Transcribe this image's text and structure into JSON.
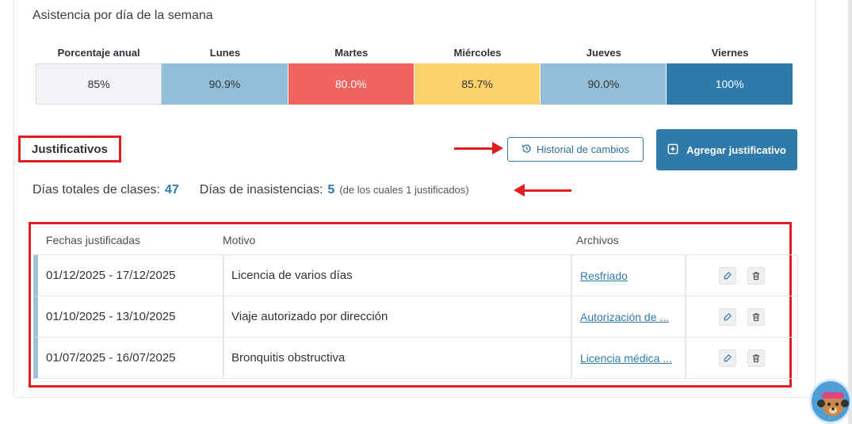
{
  "attendance": {
    "title": "Asistencia por día de la semana",
    "headers": [
      "Porcentaje anual",
      "Lunes",
      "Martes",
      "Miércoles",
      "Jueves",
      "Viernes"
    ],
    "values": [
      "85%",
      "90.9%",
      "80.0%",
      "85.7%",
      "90.0%",
      "100%"
    ],
    "colors": [
      "#f2f3f6",
      "#94bed8",
      "#ef6461",
      "#fdd26b",
      "#94bed8",
      "#2e7bab"
    ],
    "text_colors": [
      "#333333",
      "#2f3337",
      "#ffffff",
      "#2f3337",
      "#2f3337",
      "#ffffff"
    ]
  },
  "justificativos": {
    "title": "Justificativos",
    "history_button": "Historial de cambios",
    "add_button": "Agregar justificativo",
    "total_days_label": "Días totales de clases:",
    "total_days_value": "47",
    "absences_label": "Días de inasistencias:",
    "absences_value": "5",
    "absences_note": "(de los cuales 1 justificados)"
  },
  "table": {
    "headers": {
      "dates": "Fechas justificadas",
      "reason": "Motivo",
      "files": "Archivos"
    },
    "rows": [
      {
        "dates": "01/12/2025 - 17/12/2025",
        "reason": "Licencia de varios días",
        "file": "Resfriado"
      },
      {
        "dates": "01/10/2025 - 13/10/2025",
        "reason": "Viaje autorizado por dirección",
        "file": "Autorización de ..."
      },
      {
        "dates": "01/07/2025 - 16/07/2025",
        "reason": "Bronquitis obstructiva",
        "file": "Licencia médica ..."
      }
    ]
  }
}
